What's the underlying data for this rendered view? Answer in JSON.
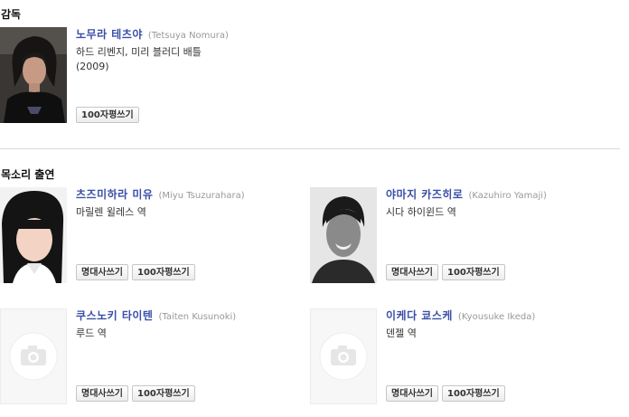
{
  "director_section": {
    "title": "감독",
    "people": [
      {
        "name": "노무라 테츠야",
        "english_name": "(Tetsuya Nomura)",
        "works": "하드 리벤지, 미리 블러디 배틀",
        "year": "(2009)",
        "review_button": "100자평쓰기"
      }
    ]
  },
  "voice_section": {
    "title": "목소리 출연",
    "people": [
      {
        "name": "츠즈미하라 미유",
        "english_name": "(Miyu Tsuzurahara)",
        "role": "마릴렌 윌레스 역",
        "quote_button": "명대사쓰기",
        "review_button": "100자평쓰기"
      },
      {
        "name": "야마지 카즈히로",
        "english_name": "(Kazuhiro Yamaji)",
        "role": "시다 하이윈드 역",
        "quote_button": "명대사쓰기",
        "review_button": "100자평쓰기"
      },
      {
        "name": "쿠스노키 타이텐",
        "english_name": "(Taiten Kusunoki)",
        "role": "루드 역",
        "quote_button": "명대사쓰기",
        "review_button": "100자평쓰기"
      },
      {
        "name": "이케다 쿄스케",
        "english_name": "(Kyousuke Ikeda)",
        "role": "덴젤 역",
        "quote_button": "명대사쓰기",
        "review_button": "100자평쓰기"
      }
    ]
  }
}
